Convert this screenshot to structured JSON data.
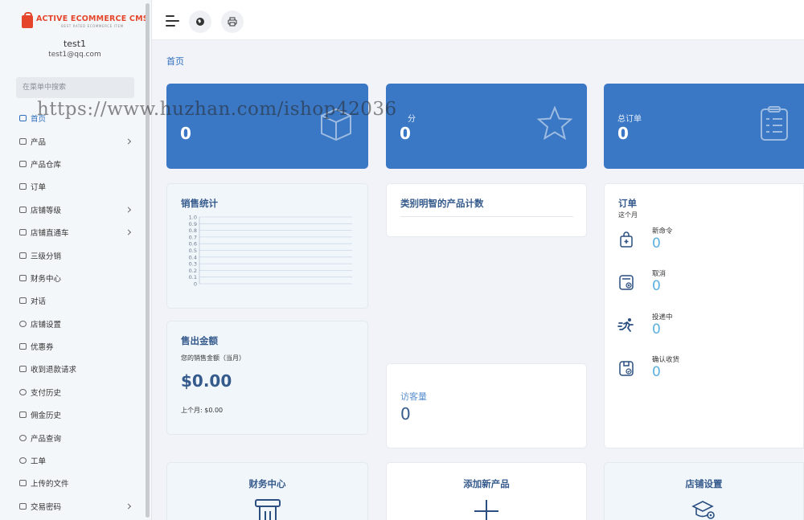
{
  "sidebar": {
    "logo_main": "ACTIVE ECOMMERCE CMS",
    "logo_sub": "BEST RATED ECOMMERCE ITEM",
    "user_name": "test1",
    "user_email": "test1@qq.com",
    "search_placeholder": "在菜单中搜索",
    "items": [
      {
        "label": "首页",
        "icon": "home-icon",
        "chevron": false
      },
      {
        "label": "产品",
        "icon": "cart-icon",
        "chevron": true
      },
      {
        "label": "产品仓库",
        "icon": "box-icon",
        "chevron": false
      },
      {
        "label": "订单",
        "icon": "money-icon",
        "chevron": false
      },
      {
        "label": "店铺等级",
        "icon": "cart-icon",
        "chevron": true
      },
      {
        "label": "店铺直通车",
        "icon": "cart-icon",
        "chevron": true
      },
      {
        "label": "三级分销",
        "icon": "user-icon",
        "chevron": false
      },
      {
        "label": "财务中心",
        "icon": "money-icon",
        "chevron": false
      },
      {
        "label": "对话",
        "icon": "chat-icon",
        "chevron": false
      },
      {
        "label": "店铺设置",
        "icon": "gear-icon",
        "chevron": false
      },
      {
        "label": "优惠券",
        "icon": "ticket-icon",
        "chevron": false
      },
      {
        "label": "收到退款请求",
        "icon": "backward-icon",
        "chevron": false
      },
      {
        "label": "支付历史",
        "icon": "history-icon",
        "chevron": false
      },
      {
        "label": "佣金历史",
        "icon": "file-icon",
        "chevron": false
      },
      {
        "label": "产品查询",
        "icon": "clock-icon",
        "chevron": false
      },
      {
        "label": "工单",
        "icon": "gear-icon",
        "chevron": false
      },
      {
        "label": "上传的文件",
        "icon": "folder-icon",
        "chevron": false
      },
      {
        "label": "交易密码",
        "icon": "key-icon",
        "chevron": true
      }
    ]
  },
  "topbar": {
    "menu_icon": "hamburger-icon",
    "globe_icon": "globe-icon",
    "print_icon": "printer-icon"
  },
  "breadcrumb": "首页",
  "stats": [
    {
      "label": "",
      "value": "0",
      "icon": "box-icon"
    },
    {
      "label": "分",
      "value": "0",
      "icon": "star-icon"
    },
    {
      "label": "总订单",
      "value": "0",
      "icon": "clipboard-icon"
    }
  ],
  "sales_stats": {
    "title": "销售统计"
  },
  "chart_data": {
    "type": "line",
    "title": "销售统计",
    "y_ticks": [
      "1.0",
      "0.9",
      "0.8",
      "0.7",
      "0.6",
      "0.5",
      "0.4",
      "0.3",
      "0.2",
      "0.1",
      "0"
    ],
    "ylim": [
      0,
      1.0
    ],
    "grid": true,
    "series": []
  },
  "category_products": {
    "title": "类别明智的产品计数"
  },
  "orders": {
    "title": "订单",
    "subtitle": "这个月",
    "rows": [
      {
        "label": "新命令",
        "value": "0",
        "icon": "bag-plus-icon"
      },
      {
        "label": "取消",
        "value": "0",
        "icon": "cancel-icon"
      },
      {
        "label": "投递中",
        "value": "0",
        "icon": "running-icon"
      },
      {
        "label": "确认收货",
        "value": "0",
        "icon": "delivered-icon"
      }
    ]
  },
  "sales_amount": {
    "title": "售出金额",
    "subtitle": "您的销售金额（当月）",
    "amount": "$0.00",
    "previous": "上个月: $0.00"
  },
  "visits": {
    "label": "访客量",
    "value": "0"
  },
  "quick_links": [
    {
      "label": "财务中心",
      "icon": "finance-icon"
    },
    {
      "label": "添加新产品",
      "icon": "plus-icon"
    },
    {
      "label": "店铺设置",
      "icon": "shop-settings-icon"
    }
  ],
  "watermark": "https://www.huzhan.com/ishop42036",
  "colors": {
    "accent": "#3a77c4",
    "title": "#355a8c",
    "value_light": "#5ab0e0",
    "logo": "#e5462b"
  }
}
